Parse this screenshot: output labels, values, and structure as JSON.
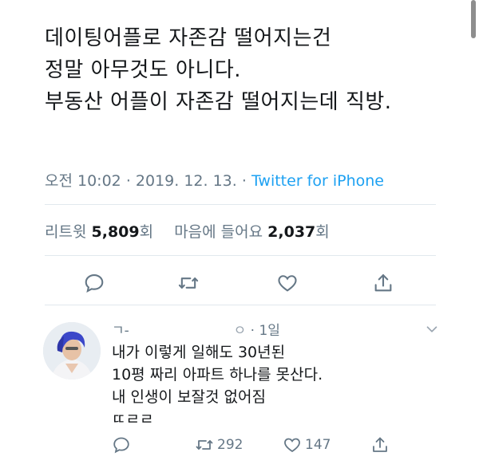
{
  "tweet": {
    "lines": [
      "데이팅어플로 자존감 떨어지는건",
      "정말 아무것도 아니다.",
      "부동산 어플이 자존감 떨어지는데 직방."
    ],
    "time": "오전 10:02",
    "date": "2019. 12. 13.",
    "source": "Twitter for iPhone",
    "retweets_label": "리트윗",
    "retweets": "5,809",
    "retweets_unit": "회",
    "likes_label": "마음에 들어요",
    "likes": "2,037",
    "likes_unit": "회"
  },
  "actions": {
    "reply_icon": "reply-icon",
    "retweet_icon": "retweet-icon",
    "like_icon": "heart-icon",
    "share_icon": "share-icon"
  },
  "reply": {
    "author_fragment": "ㄱ-",
    "handle_fragment": "ㅇ",
    "time_ago": "1일",
    "lines": [
      "내가 이렇게 일해도 30년된",
      "10평 짜리 아파트 하나를 못산다.",
      "내 인생이 보잘것 없어짐",
      "ㄸㄹㄹ"
    ],
    "retweets": "292",
    "likes": "147"
  },
  "colors": {
    "text": "#14171a",
    "muted": "#657786",
    "accent": "#1da1f2",
    "divider": "#e1e8ed"
  }
}
